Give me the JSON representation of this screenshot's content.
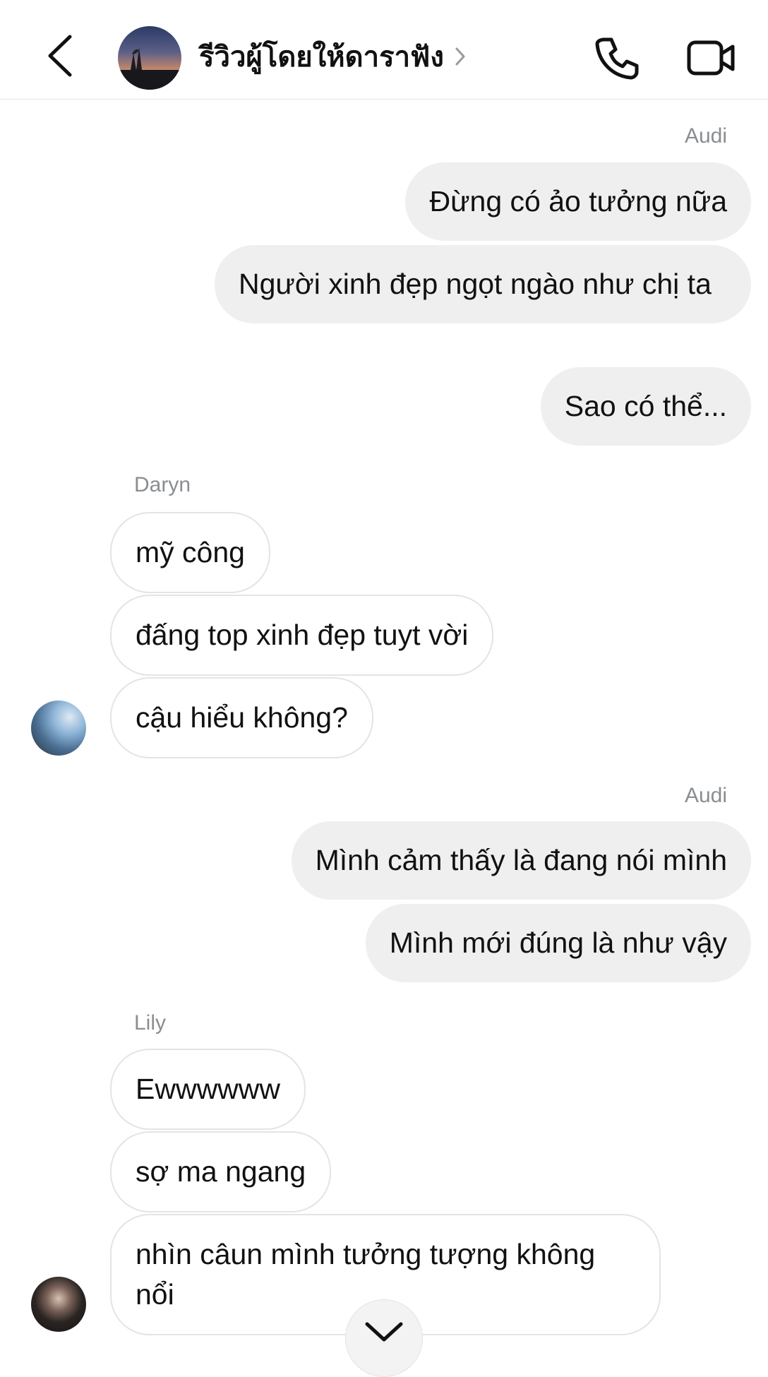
{
  "header": {
    "title": "รีวิวผู้โดยให้ดาราฟัง",
    "back_icon": "chevron-left-icon",
    "call_icon": "phone-icon",
    "video_icon": "video-camera-icon"
  },
  "messages": [
    {
      "sender": "Audi",
      "direction": "outgoing",
      "texts": [
        "Đừng có ảo tưởng nữa",
        "Người xinh đẹp ngọt ngào như chị ta",
        "Sao có thể..."
      ]
    },
    {
      "sender": "Daryn",
      "direction": "incoming",
      "texts": [
        "mỹ công",
        "đấng top xinh đẹp tuyt vời",
        "cậu hiểu không?"
      ]
    },
    {
      "sender": "Audi",
      "direction": "outgoing",
      "texts": [
        "Mình cảm thấy là đang nói mình",
        "Mình mới đúng là như vậy"
      ]
    },
    {
      "sender": "Lily",
      "direction": "incoming",
      "texts": [
        "Ewwwwww",
        "sợ ma ngang",
        "nhìn câun mình tưởng tượng không nổi"
      ]
    }
  ],
  "colors": {
    "outgoing_bubble": "#efefef",
    "incoming_border": "#e4e4e4",
    "sender_name": "#8a8d91"
  }
}
